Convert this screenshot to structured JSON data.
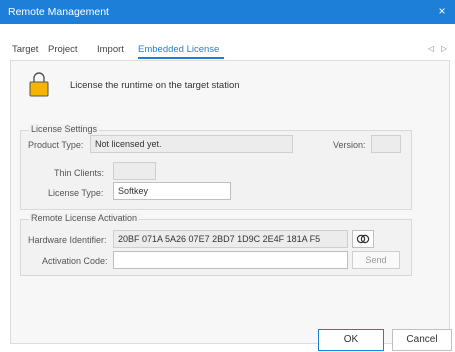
{
  "window": {
    "title": "Remote Management",
    "close_symbol": "×"
  },
  "tabs": [
    {
      "label": "Target"
    },
    {
      "label": "Project"
    },
    {
      "label": "Import"
    },
    {
      "label": "Embedded License"
    }
  ],
  "nav": {
    "left": "◁",
    "right": "▷"
  },
  "header": {
    "text": "License the runtime on the target station"
  },
  "license_settings": {
    "title": "License Settings",
    "product_type_label": "Product Type:",
    "product_type_value": "Not licensed yet.",
    "version_label": "Version:",
    "version_value": "",
    "thin_clients_label": "Thin Clients:",
    "thin_clients_value": "",
    "license_type_label": "License Type:",
    "license_type_value": "Softkey"
  },
  "remote_activation": {
    "title": "Remote License Activation",
    "hardware_id_label": "Hardware Identifier:",
    "hardware_id_value": "20BF 071A 5A26 07E7 2BD7 1D9C 2E4F 181A F5",
    "activation_code_label": "Activation Code:",
    "activation_code_value": "",
    "send_label": "Send"
  },
  "buttons": {
    "ok": "OK",
    "cancel": "Cancel"
  },
  "colors": {
    "accent": "#1e7fd8",
    "lock": "#f6b400"
  }
}
